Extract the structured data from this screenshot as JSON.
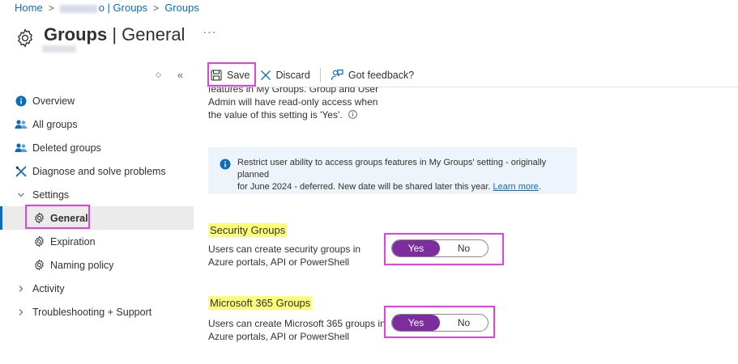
{
  "breadcrumb": {
    "home": "Home",
    "sep": ">",
    "tenant_suffix": "o | Groups",
    "groups": "Groups"
  },
  "header": {
    "title_bold": "Groups",
    "title_rest": " | General",
    "more": "···"
  },
  "sidebar": {
    "controls": {
      "expand": "◇",
      "collapse": "«"
    },
    "items": [
      {
        "label": "Overview",
        "icon": "info-icon"
      },
      {
        "label": "All groups",
        "icon": "people-icon"
      },
      {
        "label": "Deleted groups",
        "icon": "people-icon"
      },
      {
        "label": "Diagnose and solve problems",
        "icon": "wrench-icon"
      },
      {
        "label": "Settings",
        "icon": "chevron-down-icon"
      },
      {
        "label": "General",
        "icon": "gear-icon"
      },
      {
        "label": "Expiration",
        "icon": "gear-icon"
      },
      {
        "label": "Naming policy",
        "icon": "gear-icon"
      },
      {
        "label": "Activity",
        "icon": "chevron-right-icon"
      },
      {
        "label": "Troubleshooting + Support",
        "icon": "chevron-right-icon"
      }
    ]
  },
  "toolbar": {
    "save": "Save",
    "discard": "Discard",
    "feedback": "Got feedback?"
  },
  "content": {
    "partial_line1": "features in My Groups. Group and User",
    "partial_line2": "Admin will have read-only access when",
    "partial_line3": "the value of this setting is 'Yes'.",
    "info_text_1": "Restrict user ability to access groups features in My Groups' setting - originally planned",
    "info_text_2": "for June 2024 - deferred. New date will be shared later this year.",
    "info_link": "Learn more",
    "info_end": "."
  },
  "security_groups": {
    "title": "Security Groups",
    "desc": "Users can create security groups in Azure portals, API or PowerShell",
    "yes": "Yes",
    "no": "No",
    "selected": "Yes"
  },
  "m365_groups": {
    "title": "Microsoft 365 Groups",
    "desc": "Users can create Microsoft 365 groups in Azure portals, API or PowerShell",
    "yes": "Yes",
    "no": "No",
    "selected": "Yes"
  },
  "colors": {
    "link": "#0f6cbd",
    "toggle_on": "#7d2e9e",
    "highlight_box": "#e142e1",
    "highlight_fill": "#fdfd7a"
  }
}
